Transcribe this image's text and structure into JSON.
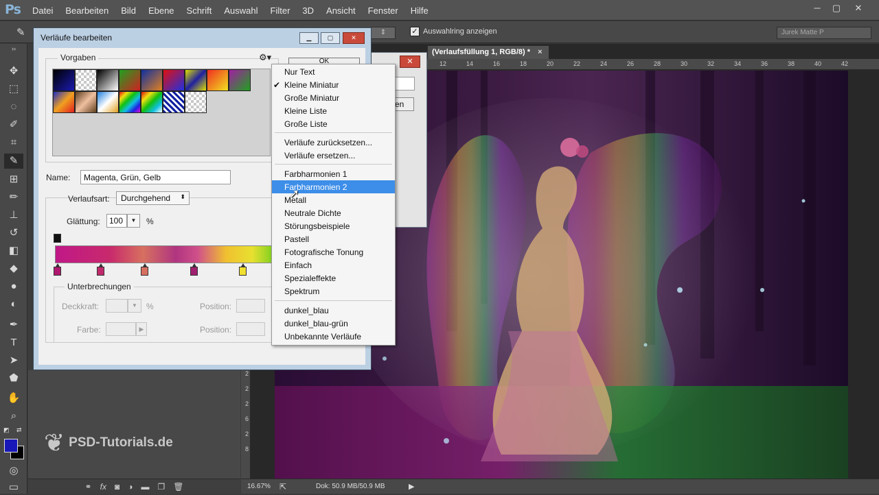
{
  "app": {
    "logo": "Ps"
  },
  "menubar": {
    "items": [
      "Datei",
      "Bearbeiten",
      "Bild",
      "Ebene",
      "Schrift",
      "Auswahl",
      "Filter",
      "3D",
      "Ansicht",
      "Fenster",
      "Hilfe"
    ]
  },
  "optionsbar": {
    "show_ring_label": "Auswahlring anzeigen",
    "show_ring_checked": true,
    "workspace_select": "Jurek Matte P"
  },
  "document": {
    "tab_title": "(Verlaufsfüllung 1, RGB/8) *",
    "tab_close": "×",
    "ruler_top": [
      "12",
      "14",
      "16",
      "18",
      "20",
      "22",
      "24",
      "26",
      "28",
      "30",
      "32",
      "34",
      "36",
      "38",
      "40",
      "42"
    ],
    "ruler_left": [
      "2",
      "2",
      "2",
      "6",
      "2",
      "8"
    ],
    "zoom": "16.67%",
    "doc_size": "Dok: 50.9 MB/50.9 MB"
  },
  "watermark": {
    "text": "PSD-Tutorials.de"
  },
  "dialog": {
    "title": "Verläufe bearbeiten",
    "presets_label": "Vorgaben",
    "ok_label": "OK",
    "name_label": "Name:",
    "name_value": "Magenta, Grün, Gelb",
    "verlaufsart_label": "Verlaufsart:",
    "verlaufsart_value": "Durchgehend",
    "glaettung_label": "Glättung:",
    "glaettung_value": "100",
    "glaettung_unit": "%",
    "unterbrechungen_label": "Unterbrechungen",
    "deckkraft_label": "Deckkraft:",
    "deckkraft_unit": "%",
    "farbe_label": "Farbe:",
    "position_label": "Position:",
    "position_label_2": "Position:",
    "presets": [
      "linear-gradient(135deg,#000,#1a1ab0)",
      "repeating-conic-gradient(#c8c8c8 0 25%,#fff 0 50%) 0 0/8px 8px",
      "linear-gradient(135deg,#000,#fff)",
      "linear-gradient(135deg,#20a020,#d02020)",
      "linear-gradient(135deg,#1030a0,#e08020)",
      "linear-gradient(135deg,#e01010,#2030e0)",
      "linear-gradient(135deg,#e0e000,#2020a0,#e0e000)",
      "linear-gradient(135deg,#f03020,#f0e020)",
      "linear-gradient(135deg,#a020a0,#20a020)",
      "linear-gradient(135deg,#2030c0,#f0a020,#e02020)",
      "linear-gradient(135deg,#604020,#f0c0a0,#604020)",
      "linear-gradient(135deg,#2080e0,#fff,#e0a020)",
      "linear-gradient(135deg,#e01010,#f0e010,#10c010,#10c0e0,#2020e0,#e010e0)",
      "linear-gradient(135deg,#e01010,#f0e010,#10c010,#10c0e0,#fff)",
      "repeating-linear-gradient(45deg,#1020a0 0 3px,#fff 3px 6px)",
      "repeating-conic-gradient(#c8c8c8 0 25%,#fff 0 50%) 0 0/8px 8px"
    ],
    "color_stops": [
      "#b01870",
      "#c02a6c",
      "#d77060",
      "#a02070",
      "#f0e030"
    ]
  },
  "dialog2": {
    "close": "✕",
    "button": "en"
  },
  "context_menu": {
    "items": [
      {
        "label": "Nur Text",
        "checked": false,
        "selected": false
      },
      {
        "label": "Kleine Miniatur",
        "checked": true,
        "selected": false
      },
      {
        "label": "Große Miniatur",
        "checked": false,
        "selected": false
      },
      {
        "label": "Kleine Liste",
        "checked": false,
        "selected": false
      },
      {
        "label": "Große Liste",
        "checked": false,
        "selected": false
      },
      {
        "label": "Verläufe zurücksetzen...",
        "checked": false,
        "selected": false
      },
      {
        "label": "Verläufe ersetzen...",
        "checked": false,
        "selected": false
      },
      {
        "label": "Farbharmonien 1",
        "checked": false,
        "selected": false
      },
      {
        "label": "Farbharmonien 2",
        "checked": false,
        "selected": true
      },
      {
        "label": "Metall",
        "checked": false,
        "selected": false
      },
      {
        "label": "Neutrale Dichte",
        "checked": false,
        "selected": false
      },
      {
        "label": "Störungsbeispiele",
        "checked": false,
        "selected": false
      },
      {
        "label": "Pastell",
        "checked": false,
        "selected": false
      },
      {
        "label": "Fotografische Tonung",
        "checked": false,
        "selected": false
      },
      {
        "label": "Einfach",
        "checked": false,
        "selected": false
      },
      {
        "label": "Spezialeffekte",
        "checked": false,
        "selected": false
      },
      {
        "label": "Spektrum",
        "checked": false,
        "selected": false
      },
      {
        "label": "dunkel_blau",
        "checked": false,
        "selected": false
      },
      {
        "label": "dunkel_blau-grün",
        "checked": false,
        "selected": false
      },
      {
        "label": "Unbekannte Verläufe",
        "checked": false,
        "selected": false
      }
    ],
    "check_glyph": "✔"
  },
  "colors": {
    "accent": "#3d8ee8",
    "foreground": "#1818b8",
    "background": "#000000"
  }
}
